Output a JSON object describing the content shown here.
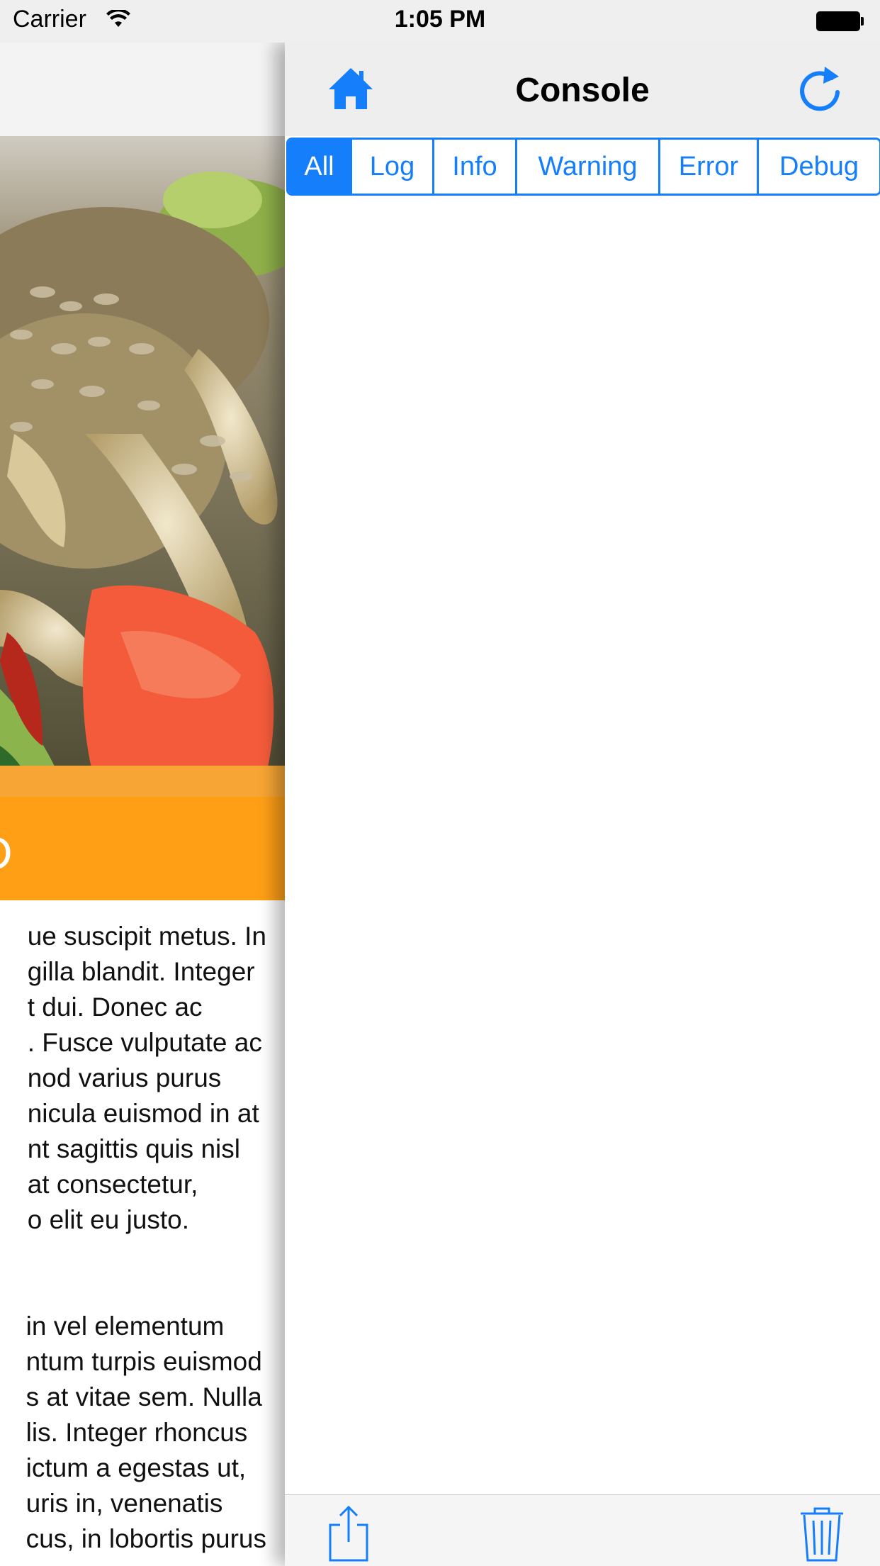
{
  "status_bar": {
    "carrier": "Carrier",
    "time": "1:05 PM",
    "wifi_icon": "wifi-icon",
    "battery_icon": "battery-icon"
  },
  "background_page": {
    "heading": "D",
    "paragraphs": [
      [
        "ue suscipit metus. In",
        "gilla blandit. Integer",
        "t dui. Donec ac",
        ". Fusce vulputate ac",
        "nod varius purus",
        "nicula euismod in at",
        "nt sagittis quis nisl",
        "at consectetur,",
        "o elit eu justo."
      ],
      [
        "in vel elementum",
        "ntum turpis euismod",
        "s at vitae sem. Nulla",
        "lis. Integer rhoncus",
        "ictum a egestas ut,",
        "uris in, venenatis",
        "cus, in lobortis purus"
      ]
    ]
  },
  "console": {
    "title": "Console",
    "home_icon": "home-icon",
    "refresh_icon": "refresh-icon",
    "filters": [
      {
        "label": "All",
        "active": true
      },
      {
        "label": "Log",
        "active": false
      },
      {
        "label": "Info",
        "active": false
      },
      {
        "label": "Warning",
        "active": false
      },
      {
        "label": "Error",
        "active": false
      },
      {
        "label": "Debug",
        "active": false
      }
    ],
    "toolbar": {
      "share_icon": "share-icon",
      "trash_icon": "trash-icon"
    }
  },
  "colors": {
    "accent": "#147efb",
    "orange": "#fe9f16",
    "bar_gray": "#eeeeee"
  }
}
